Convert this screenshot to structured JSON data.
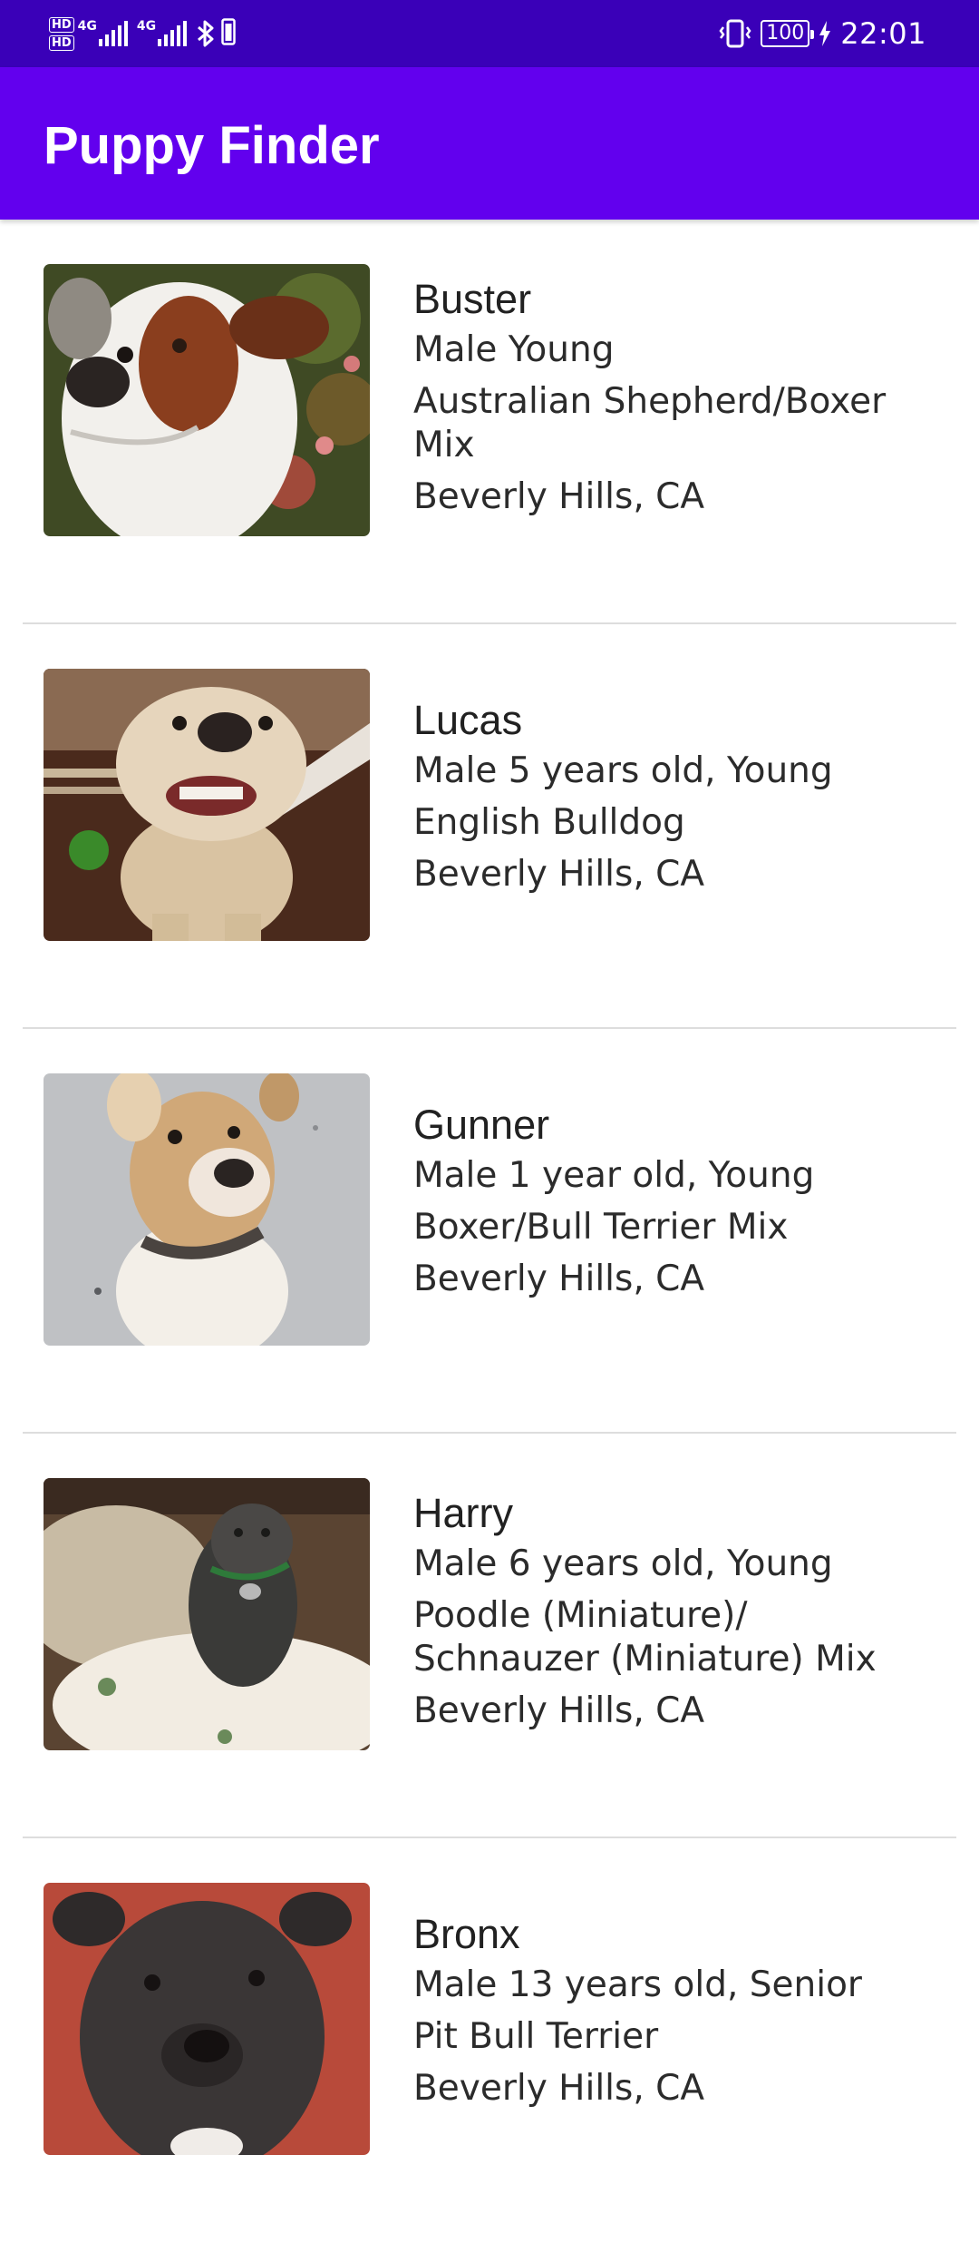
{
  "status_bar": {
    "hd1": "HD",
    "hd2": "HD",
    "sim1_tech": "4G",
    "sim2_tech": "4G",
    "battery": "100",
    "time": "22:01",
    "icons": [
      "signal-icon",
      "bluetooth-icon",
      "vibrate-icon",
      "battery-icon",
      "charging-icon"
    ]
  },
  "app_bar": {
    "title": "Puppy Finder",
    "color": "#6200ee"
  },
  "puppies": [
    {
      "name": "Buster",
      "gender_age": "Male Young",
      "breed": "Australian Shepherd/Boxer Mix",
      "location": "Beverly Hills, CA"
    },
    {
      "name": "Lucas",
      "gender_age": "Male 5 years old, Young",
      "breed": "English Bulldog",
      "location": "Beverly Hills, CA"
    },
    {
      "name": "Gunner",
      "gender_age": "Male 1 year old, Young",
      "breed": "Boxer/Bull Terrier Mix",
      "location": "Beverly Hills, CA"
    },
    {
      "name": "Harry",
      "gender_age": "Male 6 years old, Young",
      "breed": "Poodle (Miniature)/ Schnauzer (Miniature) Mix",
      "location": "Beverly Hills, CA"
    },
    {
      "name": "Bronx",
      "gender_age": "Male 13 years old, Senior",
      "breed": "Pit Bull Terrier",
      "location": "Beverly Hills, CA"
    }
  ]
}
